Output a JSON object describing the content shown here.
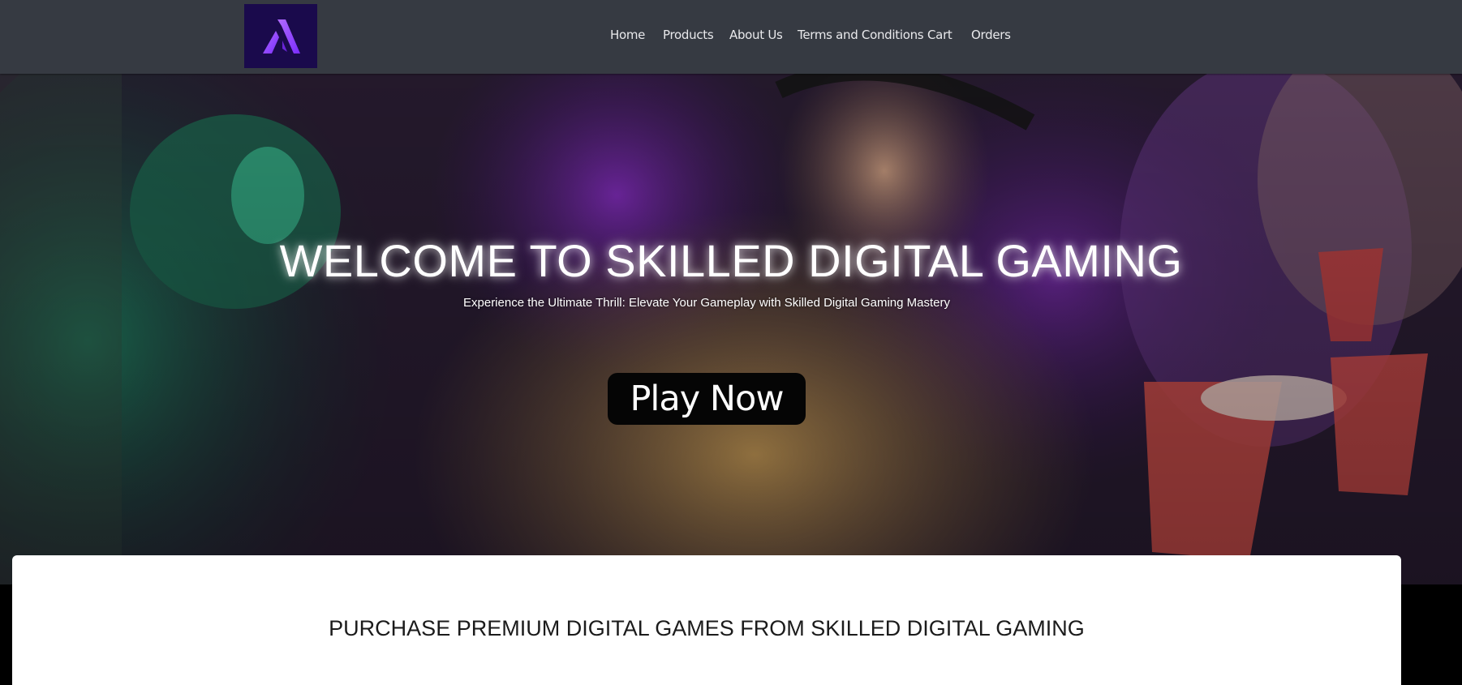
{
  "header": {
    "logo_icon": "lambda-logo-icon",
    "logo_colors": {
      "background": "#1a0a4c",
      "mark": "#9b4dff"
    },
    "nav": [
      "Home",
      "Products",
      "About Us",
      "Terms and Conditions",
      "Cart",
      "Orders"
    ]
  },
  "hero": {
    "title": "WELCOME TO SKILLED DIGITAL GAMING",
    "subtitle": "Experience the Ultimate Thrill: Elevate Your Gameplay with Skilled Digital Gaming Mastery",
    "cta_label": "Play Now",
    "image_subject": "gamers-with-headsets-photo"
  },
  "content": {
    "section_title": "PURCHASE PREMIUM DIGITAL GAMES FROM SKILLED DIGITAL GAMING"
  },
  "colors": {
    "header_bg": "#363a42",
    "button_bg": "#050505",
    "page_bg": "#000000",
    "card_bg": "#ffffff"
  }
}
